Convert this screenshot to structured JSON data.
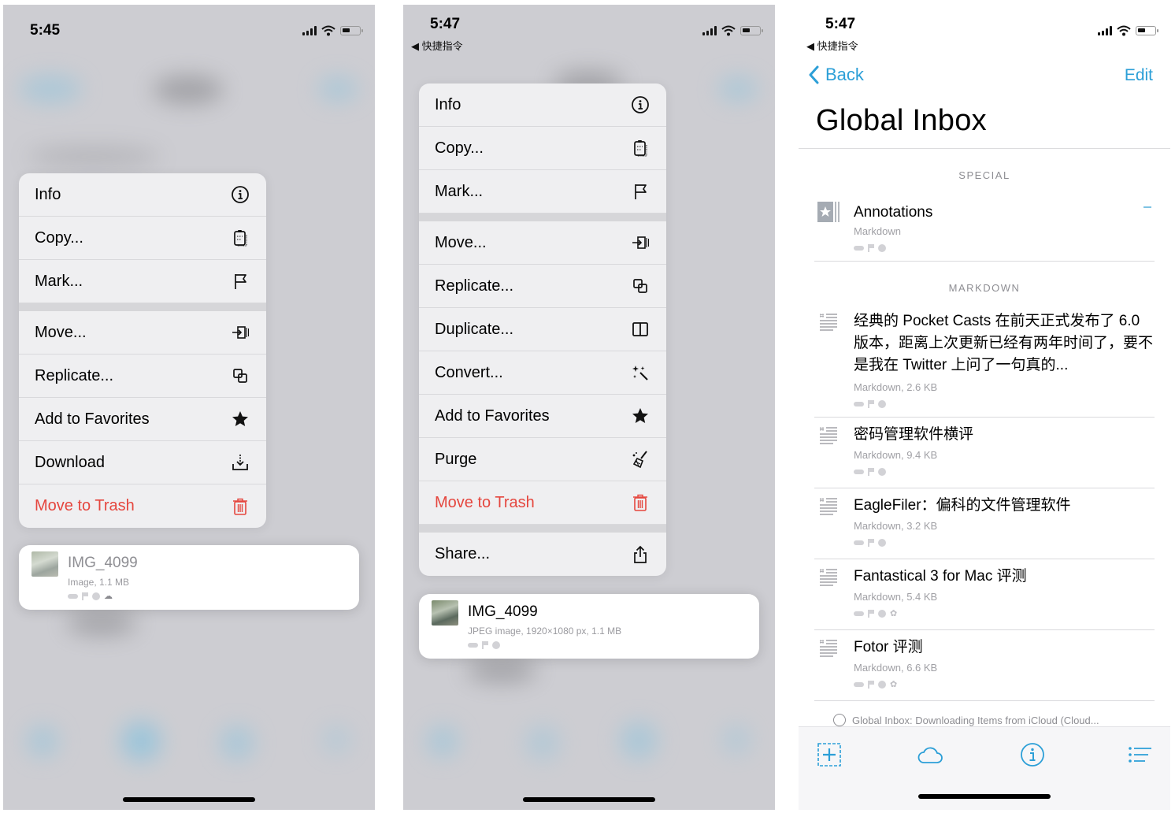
{
  "screens": [
    {
      "status": {
        "time": "5:45"
      },
      "context_menu": {
        "groups": [
          [
            {
              "label": "Info",
              "icon": "info-icon"
            },
            {
              "label": "Copy...",
              "icon": "clipboard-icon"
            },
            {
              "label": "Mark...",
              "icon": "flag-icon"
            }
          ],
          [
            {
              "label": "Move...",
              "icon": "move-icon"
            },
            {
              "label": "Replicate...",
              "icon": "replicate-icon"
            },
            {
              "label": "Add to Favorites",
              "icon": "star-icon"
            },
            {
              "label": "Download",
              "icon": "download-icon"
            },
            {
              "label": "Move to Trash",
              "icon": "trash-icon",
              "destructive": true
            }
          ]
        ]
      },
      "preview": {
        "title": "IMG_4099",
        "subtitle": "Image, 1.1 MB",
        "badges": [
          "tag",
          "flag",
          "label",
          "cloud"
        ]
      }
    },
    {
      "status": {
        "time": "5:47",
        "back_app": "◀ 快捷指令"
      },
      "context_menu": {
        "groups": [
          [
            {
              "label": "Info",
              "icon": "info-icon"
            },
            {
              "label": "Copy...",
              "icon": "clipboard-icon"
            },
            {
              "label": "Mark...",
              "icon": "flag-icon"
            }
          ],
          [
            {
              "label": "Move...",
              "icon": "move-icon"
            },
            {
              "label": "Replicate...",
              "icon": "replicate-icon"
            },
            {
              "label": "Duplicate...",
              "icon": "duplicate-icon"
            },
            {
              "label": "Convert...",
              "icon": "magic-wand-icon"
            },
            {
              "label": "Add to Favorites",
              "icon": "star-icon"
            },
            {
              "label": "Purge",
              "icon": "broom-icon"
            },
            {
              "label": "Move to Trash",
              "icon": "trash-icon",
              "destructive": true
            }
          ],
          [
            {
              "label": "Share...",
              "icon": "share-icon"
            }
          ]
        ]
      },
      "preview": {
        "title": "IMG_4099",
        "subtitle": "JPEG image, 1920×1080 px, 1.1 MB",
        "badges": [
          "tag",
          "flag",
          "label"
        ]
      }
    },
    {
      "status": {
        "time": "5:47",
        "back_app": "◀ 快捷指令"
      },
      "nav": {
        "back_label": "Back",
        "edit_label": "Edit",
        "title": "Global Inbox"
      },
      "sections": [
        {
          "header": "SPECIAL",
          "items": [
            {
              "title": "Annotations",
              "subtitle": "Markdown",
              "badges": [
                "tag",
                "flag",
                "label"
              ]
            }
          ]
        },
        {
          "header": "MARKDOWN",
          "items": [
            {
              "title": "经典的 Pocket Casts 在前天正式发布了 6.0版本，距离上次更新已经有两年时间了，要不是我在 Twitter 上问了一句真的...",
              "subtitle": "Markdown, 2.6 KB",
              "badges": [
                "tag",
                "flag",
                "label"
              ]
            },
            {
              "title": "密码管理软件横评",
              "subtitle": "Markdown, 9.4 KB",
              "badges": [
                "tag",
                "flag",
                "label"
              ]
            },
            {
              "title": "EagleFiler：偏科的文件管理软件",
              "subtitle": "Markdown, 3.2 KB",
              "badges": [
                "tag",
                "flag",
                "label"
              ]
            },
            {
              "title": "Fantastical 3 for Mac 评测",
              "subtitle": "Markdown, 5.4 KB",
              "badges": [
                "tag",
                "flag",
                "label",
                "gear"
              ]
            },
            {
              "title": "Fotor 评测",
              "subtitle": "Markdown, 6.6 KB",
              "badges": [
                "tag",
                "flag",
                "label",
                "gear"
              ]
            }
          ]
        }
      ],
      "sync_status": "Global Inbox: Downloading Items from iCloud (Cloud...",
      "toolbar": [
        "add-icon",
        "cloud-icon",
        "info-icon",
        "list-icon"
      ]
    }
  ],
  "colors": {
    "accent": "#2c9fd7",
    "destructive": "#e5463e",
    "menu_bg": "#efeff1",
    "blur_bg": "#cdcdd2"
  }
}
